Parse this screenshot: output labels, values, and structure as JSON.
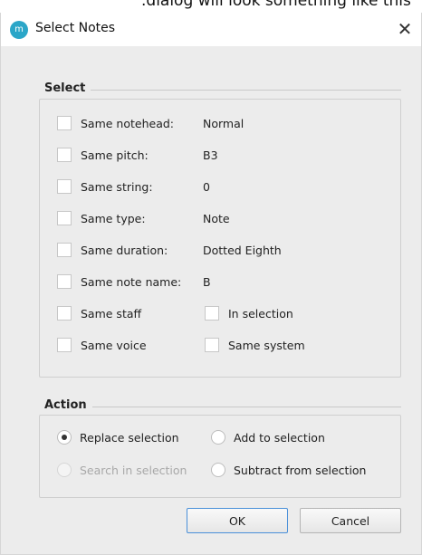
{
  "caption": ".dialog will look something like this",
  "window": {
    "title": "Select Notes",
    "app_icon_glyph": "m",
    "close_glyph": "✕"
  },
  "select_group": {
    "title": "Select",
    "rows": [
      {
        "label": "Same notehead:",
        "value": "Normal",
        "checked": false
      },
      {
        "label": "Same pitch:",
        "value": "B3",
        "checked": false
      },
      {
        "label": "Same string:",
        "value": "0",
        "checked": false
      },
      {
        "label": "Same type:",
        "value": "Note",
        "checked": false
      },
      {
        "label": "Same duration:",
        "value": "Dotted Eighth",
        "checked": false
      },
      {
        "label": "Same note name:",
        "value": "B",
        "checked": false
      }
    ],
    "extra": [
      {
        "label": "Same staff",
        "checked": false
      },
      {
        "label": "In selection",
        "checked": false
      },
      {
        "label": "Same voice",
        "checked": false
      },
      {
        "label": "Same system",
        "checked": false
      }
    ]
  },
  "action_group": {
    "title": "Action",
    "options": [
      {
        "label": "Replace selection",
        "checked": true,
        "enabled": true
      },
      {
        "label": "Add to selection",
        "checked": false,
        "enabled": true
      },
      {
        "label": "Search in selection",
        "checked": false,
        "enabled": false
      },
      {
        "label": "Subtract from selection",
        "checked": false,
        "enabled": true
      }
    ]
  },
  "buttons": {
    "ok": "OK",
    "cancel": "Cancel"
  },
  "colors": {
    "app_icon": "#2ba6c8",
    "default_button_border": "#4a90d9"
  }
}
